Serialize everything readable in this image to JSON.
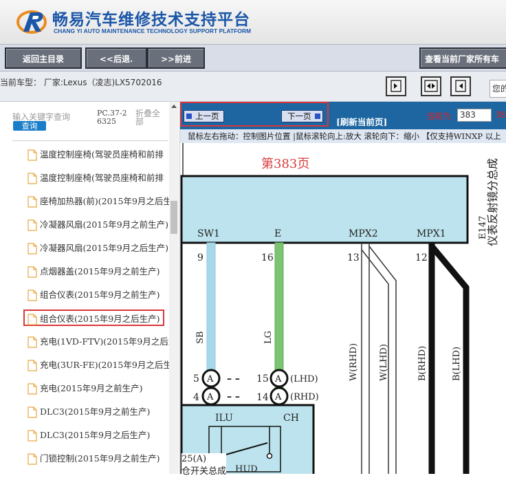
{
  "header": {
    "title_cn": "畅易汽车维修技术支持平台",
    "title_en": "CHANG YI AUTO MAINTENANCE TECHNOLOGY SUPPORT PLATFORM"
  },
  "toolbar": {
    "home_label": "返回主目录",
    "back_label": "<<后退.",
    "forward_label": ">>前进",
    "all_label": "查看当前厂家所有车"
  },
  "model": {
    "text": "当前车型： 厂家:Lexus（凌志)LX5702016",
    "hello": "您的"
  },
  "sidebar": {
    "search_placeholder": "输入关键字查询",
    "search_button": "查询",
    "pc_code": "PC.37-26325",
    "fold_all": "折叠全部",
    "items": [
      {
        "label": "温度控制座椅(驾驶员座椅和前排"
      },
      {
        "label": "温度控制座椅(驾驶员座椅和前排"
      },
      {
        "label": "座椅加热器(前)(2015年9月之后生"
      },
      {
        "label": "冷凝器风扇(2015年9月之前生产)"
      },
      {
        "label": "冷凝器风扇(2015年9月之后生产)"
      },
      {
        "label": "点烟器盖(2015年9月之前生产)"
      },
      {
        "label": "组合仪表(2015年9月之前生产)"
      },
      {
        "label": "组合仪表(2015年9月之后生产)"
      },
      {
        "label": "充电(1VD-FTV)(2015年9月之后生"
      },
      {
        "label": "充电(3UR-FE)(2015年9月之后生"
      },
      {
        "label": "充电(2015年9月之前生产)"
      },
      {
        "label": "DLC3(2015年9月之前生产)"
      },
      {
        "label": "DLC3(2015年9月之后生产)"
      },
      {
        "label": "门锁控制(2015年9月之前生产)"
      }
    ]
  },
  "viewer": {
    "prev_label": "上一页",
    "next_label": "下一页",
    "refresh_label": "[刷新当前页]",
    "current_label": "当前为",
    "current_page": "383",
    "current_tail": "38",
    "hint": "鼠标左右拖动：控制图片位置 |鼠标滚轮向上:放大  滚轮向下：缩小 【仅支持WINXP 以上"
  },
  "diagram": {
    "page_title": "第383页",
    "component_code": "E147",
    "component_name": "仪表反射镜分总成",
    "pins": [
      "SW1",
      "E",
      "MPX2",
      "MPX1"
    ],
    "pin_numbers": [
      "9",
      "16",
      "13",
      "12"
    ],
    "wire_colors": [
      "SB",
      "LG",
      "W(RHD)",
      "W(LHD)",
      "B(RHD)",
      "B(LHD)"
    ],
    "connectors": [
      {
        "left": "5",
        "right": "15",
        "tag": "(LHD)"
      },
      {
        "left": "4",
        "right": "14",
        "tag": "(RHD)"
      }
    ],
    "conn_letter": "A",
    "lower_labels": [
      "ILU",
      "CH",
      "HUD"
    ],
    "lower_code": "25(A)",
    "lower_name": "仓开关总成"
  },
  "colors": {
    "brand_blue": "#1b56a8",
    "viewer_bar": "#1d66a2",
    "highlight_red": "#d9363b",
    "diagram_box": "#bde4ee"
  }
}
